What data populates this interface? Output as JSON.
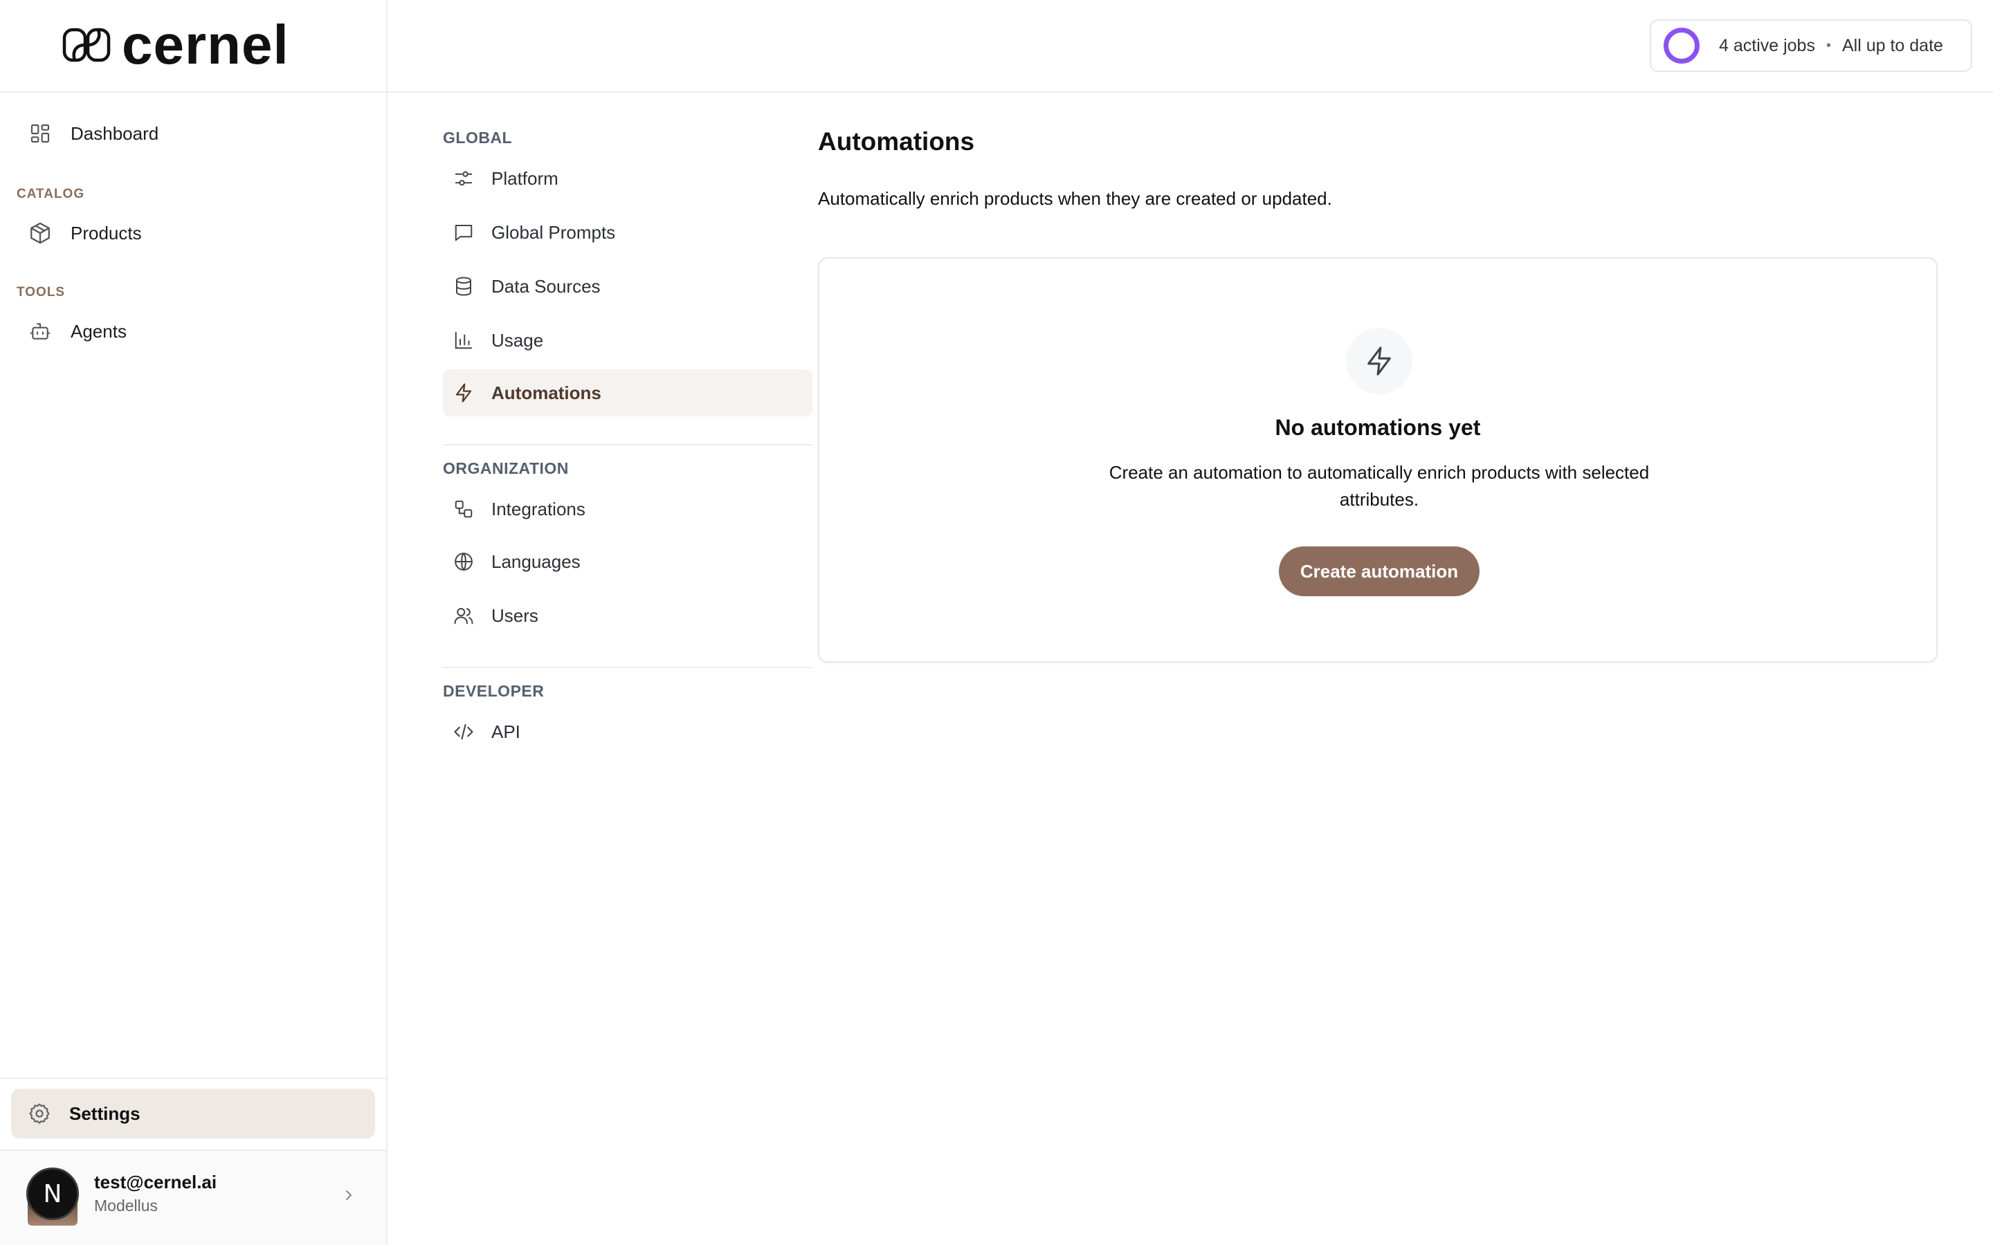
{
  "brand": {
    "name": "cernel"
  },
  "sidebar": {
    "items": [
      {
        "label": "Dashboard",
        "icon": "dashboard-grid-icon"
      },
      {
        "label": "Products",
        "icon": "package-icon"
      },
      {
        "label": "Agents",
        "icon": "bot-icon"
      }
    ],
    "sections": {
      "catalog": "CATALOG",
      "tools": "TOOLS"
    },
    "settings_label": "Settings",
    "user": {
      "avatar_initial": "N",
      "email": "test@cernel.ai",
      "org": "Modellus"
    }
  },
  "topbar": {
    "jobs_label": "4 active jobs",
    "separator": "•",
    "status_label": "All up to date",
    "ring_color": "#8a52f2"
  },
  "settings_nav": {
    "global_heading": "GLOBAL",
    "global_items": [
      {
        "label": "Platform",
        "icon": "sliders-icon"
      },
      {
        "label": "Global Prompts",
        "icon": "message-square-icon"
      },
      {
        "label": "Data Sources",
        "icon": "database-icon"
      },
      {
        "label": "Usage",
        "icon": "bar-chart-icon"
      },
      {
        "label": "Automations",
        "icon": "zap-icon",
        "active": true
      }
    ],
    "organization_heading": "ORGANIZATION",
    "organization_items": [
      {
        "label": "Integrations",
        "icon": "workflow-icon"
      },
      {
        "label": "Languages",
        "icon": "globe-icon"
      },
      {
        "label": "Users",
        "icon": "users-icon"
      }
    ],
    "developer_heading": "DEVELOPER",
    "developer_items": [
      {
        "label": "API",
        "icon": "code-icon"
      }
    ]
  },
  "main": {
    "title": "Automations",
    "description": "Automatically enrich products when they are created or updated.",
    "empty_state": {
      "icon": "zap-icon",
      "title": "No automations yet",
      "description": "Create an automation to automatically enrich products with selected attributes.",
      "button_label": "Create automation"
    }
  },
  "colors": {
    "accent_brown": "#8d6c5c",
    "active_bg": "#f5f2ef",
    "settings_bg": "#efe9e4",
    "section_label": "#8a6d5a"
  }
}
